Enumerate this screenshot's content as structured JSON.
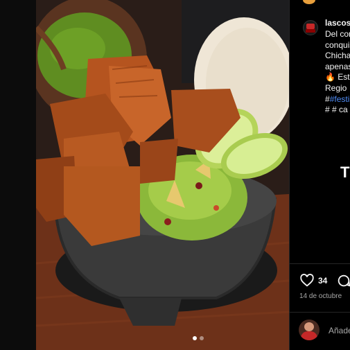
{
  "post": {
    "username": "lascost",
    "caption_lines": [
      "Del cor",
      "conquis",
      "Chicha",
      "apenas",
      "Est",
      "Regio"
    ],
    "hashtag_line_prefix": "#",
    "hashtag_line_tag": "#festi",
    "hashtag_line2": "#  # ca",
    "pending_letter": "T",
    "likes": "34",
    "date": "14 de octubre",
    "add_comment_placeholder": "Añade",
    "carousel": {
      "total": 2,
      "current": 1
    }
  },
  "icons": {
    "next": "chevron-right-icon",
    "like": "heart-icon",
    "comment": "comment-icon",
    "fire": "fire-emoji-icon"
  },
  "colors": {
    "background": "#000000",
    "text": "#f5f5f5",
    "secondary_text": "#a8a8a8",
    "link": "#4f8cf6"
  }
}
